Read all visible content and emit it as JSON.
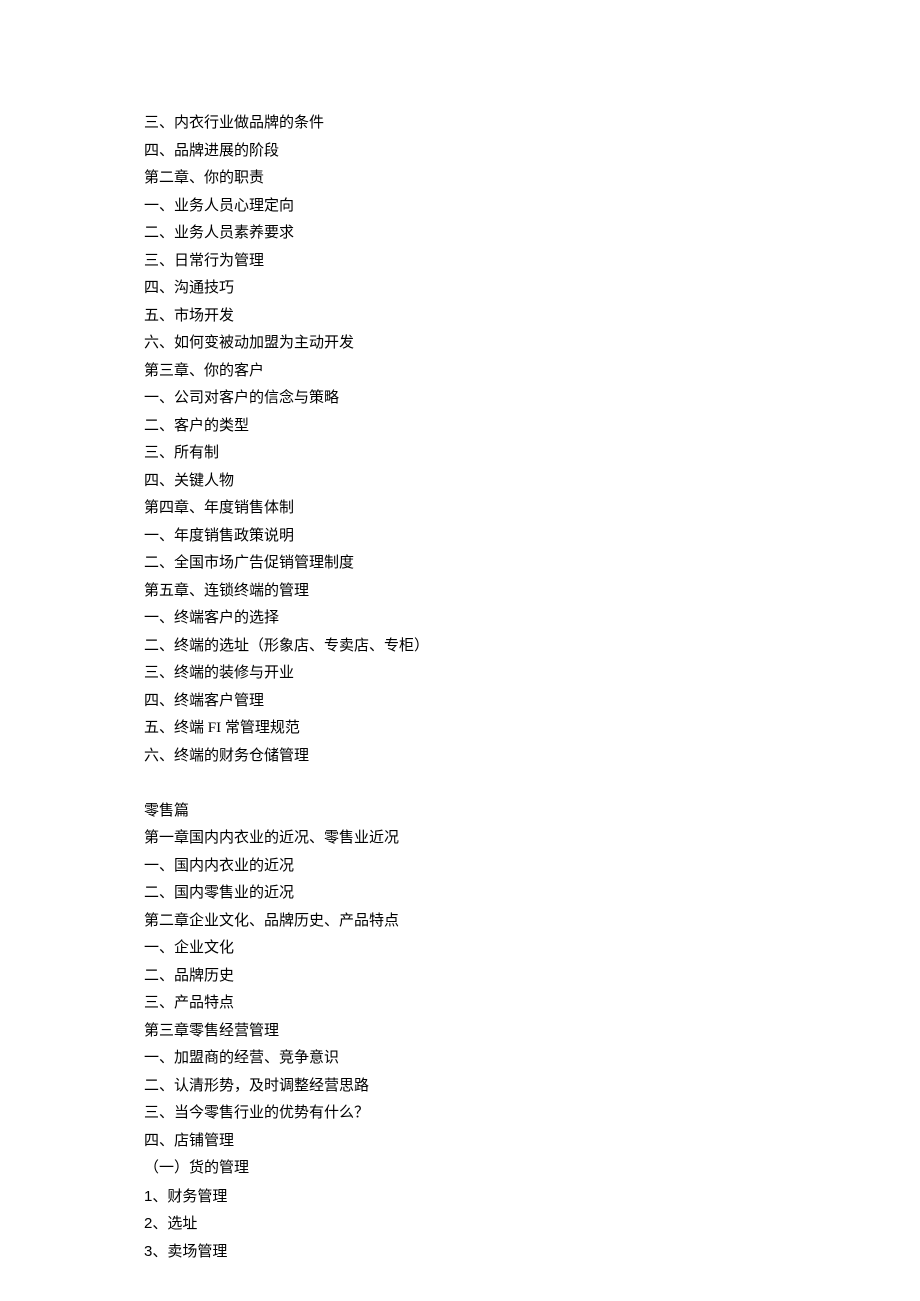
{
  "lines": [
    {
      "text": "三、内衣行业做品牌的条件",
      "class": "line"
    },
    {
      "text": "四、品牌进展的阶段",
      "class": "line"
    },
    {
      "text": "第二章、你的职责",
      "class": "line"
    },
    {
      "text": "一、业务人员心理定向",
      "class": "line"
    },
    {
      "text": "二、业务人员素养要求",
      "class": "line"
    },
    {
      "text": "三、日常行为管理",
      "class": "line"
    },
    {
      "text": "四、沟通技巧",
      "class": "line"
    },
    {
      "text": "五、市场开发",
      "class": "line"
    },
    {
      "text": "六、如何变被动加盟为主动开发",
      "class": "line"
    },
    {
      "text": "第三章、你的客户",
      "class": "line"
    },
    {
      "text": "一、公司对客户的信念与策略",
      "class": "line"
    },
    {
      "text": "二、客户的类型",
      "class": "line"
    },
    {
      "text": "三、所有制",
      "class": "line"
    },
    {
      "text": "四、关键人物",
      "class": "line"
    },
    {
      "text": "第四章、年度销售体制",
      "class": "line"
    },
    {
      "text": "一、年度销售政策说明",
      "class": "line"
    },
    {
      "text": "二、全国市场广告促销管理制度",
      "class": "line"
    },
    {
      "text": "第五章、连锁终端的管理",
      "class": "line"
    },
    {
      "text": "一、终端客户的选择",
      "class": "line"
    },
    {
      "text": "二、终端的选址（形象店、专卖店、专柜）",
      "class": "line"
    },
    {
      "text": "三、终端的装修与开业",
      "class": "line"
    },
    {
      "text": "四、终端客户管理",
      "class": "line"
    },
    {
      "text": "五、终端 FI 常管理规范",
      "class": "line"
    },
    {
      "text": "六、终端的财务仓储管理",
      "class": "line"
    },
    {
      "text": "",
      "class": "line"
    },
    {
      "text": "零售篇",
      "class": "line"
    },
    {
      "text": "第一章国内内衣业的近况、零售业近况",
      "class": "line"
    },
    {
      "text": "一、国内内衣业的近况",
      "class": "line"
    },
    {
      "text": "二、国内零售业的近况",
      "class": "line"
    },
    {
      "text": "第二章企业文化、品牌历史、产品特点",
      "class": "line"
    },
    {
      "text": "一、企业文化",
      "class": "line"
    },
    {
      "text": "二、品牌历史",
      "class": "line"
    },
    {
      "text": "三、产品特点",
      "class": "line"
    },
    {
      "text": "第三章零售经营管理",
      "class": "line"
    },
    {
      "text": "一、加盟商的经营、竞争意识",
      "class": "line"
    },
    {
      "text": "二、认清形势，及时调整经营思路",
      "class": "line"
    },
    {
      "text": "三、当今零售行业的优势有什么？",
      "class": "line"
    },
    {
      "text": "四、店铺管理",
      "class": "line"
    },
    {
      "text": "（一）货的管理",
      "class": "line"
    },
    {
      "text": "1、财务管理",
      "class": "line numbered"
    },
    {
      "text": "2、选址",
      "class": "line numbered"
    },
    {
      "text": "3、卖场管理",
      "class": "line numbered"
    }
  ]
}
